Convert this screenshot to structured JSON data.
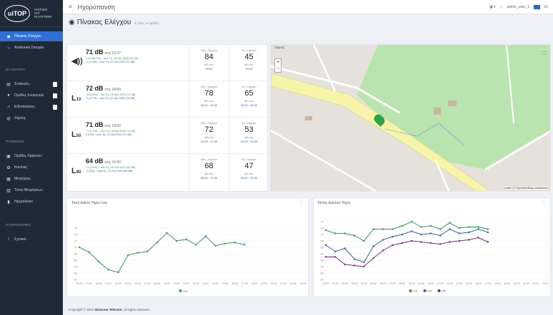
{
  "logo": {
    "badge": "uiTOP",
    "side": "UNIFIED IOT PLATFORM"
  },
  "sidebar": {
    "items": [
      {
        "label": "Πίνακας Ελέγχου",
        "icon": "dashboard-icon"
      },
      {
        "label": "Αναλυτικά Στοιχεία",
        "icon": "chart-icon"
      }
    ],
    "sections": [
      {
        "header": "ΔΙΑΧΕΙΡΙΣΗ",
        "items": [
          {
            "label": "Συσκευές"
          },
          {
            "label": "Ομάδες Συσκευών"
          },
          {
            "label": "Ειδοποιήσεις"
          },
          {
            "label": "Χάρτης"
          }
        ]
      },
      {
        "header": "ΡΥΘΜΙΣΕΙΣ",
        "items": [
          {
            "label": "Ομάδες Χρηστών"
          },
          {
            "label": "Κανόνες"
          },
          {
            "label": "Μετρήσεις"
          },
          {
            "label": "Τύποι Μετρήσεων"
          },
          {
            "label": "Ημερολόγιο"
          }
        ]
      },
      {
        "header": "ΠΛΗΡΟΦΟΡΙΕΣ",
        "items": [
          {
            "label": "Σχετικά"
          }
        ]
      }
    ]
  },
  "topbar": {
    "title": "Ηχορύπανση",
    "user": "admin_user_1",
    "lang": "EL"
  },
  "page": {
    "title": "Πίνακας Ελέγχου",
    "subtitle": "Όλες οι ομάδες"
  },
  "summary": [
    {
      "icon": "speaker-icon",
      "value": "71 dB",
      "at": "στις 19:37",
      "line1": "+10 (66.4%) ↑ από Τη, 18 Οκτ 2022 (61 dB)",
      "line2": "-1 (1.4%) ↓ από Τη, 12 Οκτ 2022 (72 dB)",
      "max": {
        "label": "Μέγ. Σήμερα",
        "value": "84",
        "s": "dB στις",
        "time": "09:54"
      },
      "min": {
        "label": "Ελ. Σήμερα",
        "value": "45",
        "s": "dB στις",
        "time": "03:43"
      }
    },
    {
      "icon": "L10",
      "value": "72 dB",
      "at": "στις 18:00",
      "line1": "+5 (6.5%) ↑ από Τη, 18 Οκτ 2022 (72 dB)",
      "line2": "-2 (2.7%) ↓ από Τη, 12 Οκτ 2022 (74 dB)",
      "max": {
        "label": "Μέγ. Σήμερα",
        "value": "78",
        "s": "dB στις",
        "time": "09:00 - 10:00"
      },
      "min": {
        "label": "Ελ. Σήμερα",
        "value": "65",
        "s": "dB στις",
        "time": "04:00 - 05:00"
      }
    },
    {
      "icon": "L50",
      "value": "71 dB",
      "at": "στις 18:00",
      "line1": "+1 (1.4%) ↑ από Τη, 18 Οκτ 2022 (70 dB)",
      "line2": "0 (0%) ↓ από Τη, 12 Οκτ 2022 (71 dB)",
      "max": {
        "label": "Μέγ. Σήμερα",
        "value": "72",
        "s": "dB στις",
        "time": "16:00 - 17:00"
      },
      "min": {
        "label": "Ελ. Σήμερα",
        "value": "53",
        "s": "dB στις",
        "time": "04:00 - 05:00"
      }
    },
    {
      "icon": "L90",
      "value": "64 dB",
      "at": "στις 18:00",
      "line1": "+1 (1.6%) ↑ από Τη, 18 Οκτ 2022 (63 dB)",
      "line2": "-2 (3%) ↓ από Τη, 12 Οκτ 2022 (66 dB)",
      "max": {
        "label": "Μέγ. Σήμερα",
        "value": "68",
        "s": "dB στις",
        "time": "09:00 - 10:00"
      },
      "min": {
        "label": "Ελ. Σήμερα",
        "value": "47",
        "s": "dB στις",
        "time": "04:00 - 05:00"
      }
    }
  ],
  "map": {
    "title": "Χάρτης",
    "attribution": "Leaflet | © OpenStreetMap contributors"
  },
  "chart1": {
    "title": "Τάση Δείκτη Ήχου Leq"
  },
  "chart2": {
    "title": "Τάσεις Δεικτών Ήχου"
  },
  "chart_data": [
    {
      "type": "line",
      "title": "Τάση Δείκτη Ήχου Leq",
      "categories": [
        "00:00",
        "01:00",
        "02:00",
        "03:00",
        "04:00",
        "05:00",
        "06:00",
        "07:00",
        "08:00",
        "09:00",
        "10:00",
        "11:00",
        "12:00",
        "13:00",
        "14:00",
        "15:00",
        "16:00",
        "17:00",
        "18:00",
        "19:00",
        "20:00",
        "21:00",
        "22:00",
        "23:00"
      ],
      "ylim": [
        60,
        80
      ],
      "yticks": [
        60,
        62,
        64,
        66,
        68,
        70,
        72,
        74,
        76
      ],
      "series": [
        {
          "name": "Leq",
          "color": "#2aa34a",
          "values": [
            70,
            68.5,
            65.5,
            63,
            62.2,
            67.5,
            68.3,
            68.7,
            71.5,
            74.5,
            72,
            72.5,
            70.8,
            73.5,
            70.5,
            71.2,
            71.5,
            70.8
          ]
        }
      ]
    },
    {
      "type": "line",
      "title": "Τάσεις Δεικτών Ήχου",
      "categories": [
        "00:00",
        "01:00",
        "02:00",
        "03:00",
        "04:00",
        "05:00",
        "06:00",
        "07:00",
        "08:00",
        "09:00",
        "10:00",
        "11:00",
        "12:00",
        "13:00",
        "14:00",
        "15:00",
        "16:00",
        "17:00",
        "18:00",
        "19:00",
        "20:00",
        "21:00",
        "22:00",
        "23:00"
      ],
      "ylim": [
        50,
        80
      ],
      "yticks": [
        50,
        53,
        56,
        59,
        62,
        65,
        68,
        71,
        74,
        77
      ],
      "series": [
        {
          "name": "L10",
          "color": "#2aa34a",
          "values": [
            73,
            71.5,
            71.5,
            70.5,
            68,
            73.5,
            73.5,
            73.5,
            75,
            77,
            74.5,
            75,
            73.5,
            76.5,
            74,
            74.5,
            74.5,
            73.5
          ]
        },
        {
          "name": "L50",
          "color": "#2b64c4",
          "values": [
            66,
            63,
            64.5,
            59.5,
            58,
            65.5,
            68.5,
            70,
            71,
            72.5,
            71,
            71.5,
            70.5,
            73.5,
            71.5,
            72,
            73.5,
            72
          ]
        },
        {
          "name": "L90",
          "color": "#7b2a8c",
          "values": [
            60.5,
            60.5,
            57,
            56.5,
            56,
            60,
            63.5,
            66,
            67,
            68,
            67.5,
            67,
            66.5,
            67.5,
            68,
            68.5,
            69.5,
            67.5
          ]
        }
      ]
    }
  ],
  "footer": {
    "text": "Copyright © 2022 ",
    "brand": "Intracom Telecom",
    "rest": ". All rights reserved."
  }
}
